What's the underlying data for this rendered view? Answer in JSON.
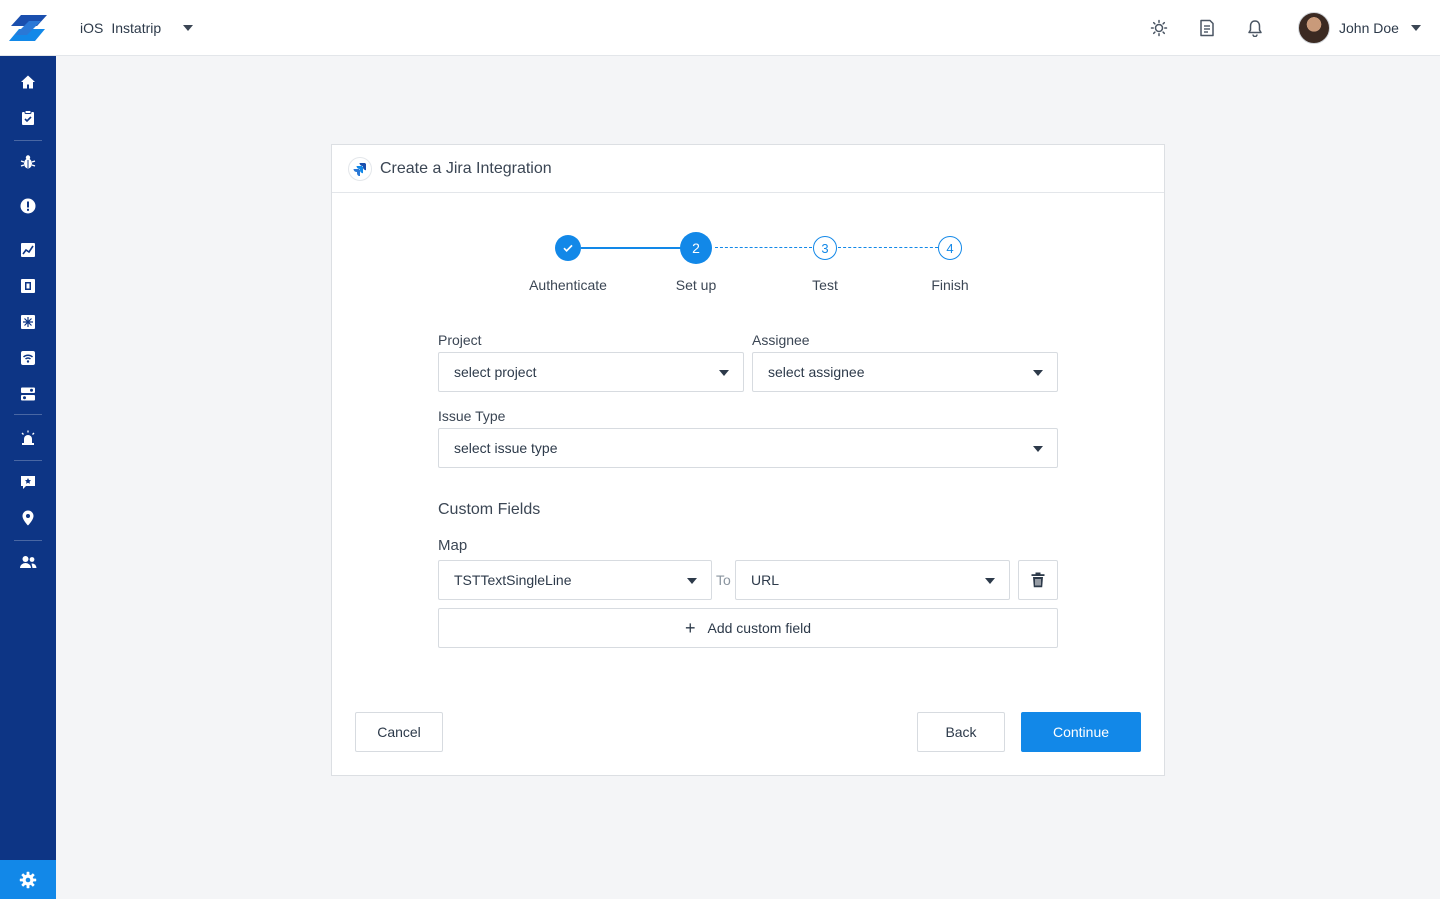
{
  "header": {
    "platform": "iOS",
    "app_name": "Instatrip",
    "user_name": "John Doe"
  },
  "card": {
    "title": "Create a Jira Integration"
  },
  "stepper": {
    "steps": [
      {
        "number": "1",
        "label": "Authenticate",
        "state": "done"
      },
      {
        "number": "2",
        "label": "Set up",
        "state": "active"
      },
      {
        "number": "3",
        "label": "Test",
        "state": "todo"
      },
      {
        "number": "4",
        "label": "Finish",
        "state": "todo"
      }
    ]
  },
  "form": {
    "project_label": "Project",
    "project_value": "select project",
    "assignee_label": "Assignee",
    "assignee_value": "select assignee",
    "issue_type_label": "Issue Type",
    "issue_type_value": "select issue type",
    "custom_fields_title": "Custom Fields",
    "map_label": "Map",
    "map_from_value": "TSTTextSingleLine",
    "map_to_label": "To",
    "map_to_value": "URL",
    "add_custom_field_label": "Add custom field"
  },
  "actions": {
    "cancel": "Cancel",
    "back": "Back",
    "continue": "Continue"
  },
  "colors": {
    "accent": "#1288e8",
    "sidebar": "#0d3585"
  }
}
